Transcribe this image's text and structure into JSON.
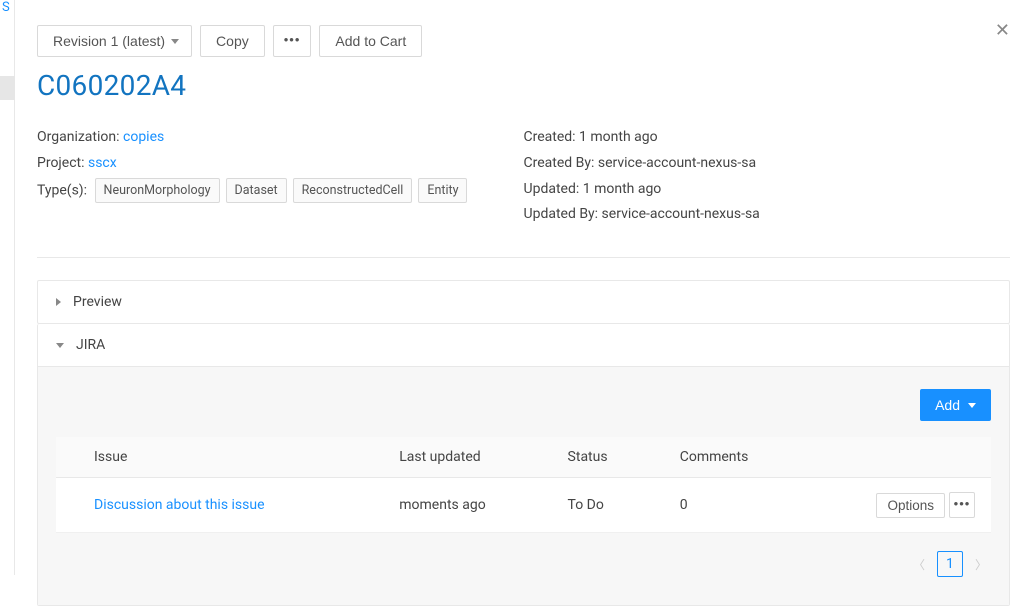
{
  "toolbar": {
    "revision_label": "Revision 1 (latest)",
    "copy_label": "Copy",
    "add_to_cart_label": "Add to Cart"
  },
  "title": "C060202A4",
  "meta_left": {
    "org_label": "Organization:",
    "org_value": "copies",
    "project_label": "Project:",
    "project_value": "sscx",
    "types_label": "Type(s):",
    "types": [
      "NeuronMorphology",
      "Dataset",
      "ReconstructedCell",
      "Entity"
    ]
  },
  "meta_right": {
    "created_label": "Created:",
    "created_value": "1 month ago",
    "created_by_label": "Created By:",
    "created_by_value": "service-account-nexus-sa",
    "updated_label": "Updated:",
    "updated_value": "1 month ago",
    "updated_by_label": "Updated By:",
    "updated_by_value": "service-account-nexus-sa"
  },
  "panels": {
    "preview_label": "Preview",
    "jira_label": "JIRA"
  },
  "jira": {
    "add_label": "Add",
    "columns": {
      "issue": "Issue",
      "last_updated": "Last updated",
      "status": "Status",
      "comments": "Comments"
    },
    "row": {
      "issue": "Discussion about this issue",
      "last_updated": "moments ago",
      "status": "To Do",
      "comments": "0",
      "options_label": "Options"
    },
    "page": "1"
  },
  "left_char": "S"
}
